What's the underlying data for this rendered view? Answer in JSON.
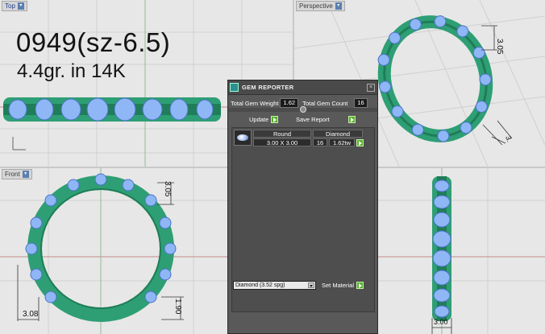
{
  "viewports": {
    "top": {
      "label": "Top"
    },
    "perspective": {
      "label": "Perspective"
    },
    "front": {
      "label": "Front"
    },
    "right": {
      "label": ""
    }
  },
  "annotation": {
    "line1": "0949(sz-6.5)",
    "line2": "4.4gr.  in 14K"
  },
  "dimensions": {
    "persp_height": "3.05",
    "persp_width": "3.",
    "front_height": "3.05",
    "front_bottom_width": "3.08",
    "front_bottom_height": "1.90",
    "right_width": "3.00"
  },
  "gem_reporter": {
    "title": "GEM REPORTER",
    "total_weight_label": "Total Gem Weight",
    "total_weight_value": "1.62",
    "total_count_label": "Total Gem Count",
    "total_count_value": "16",
    "update_label": "Update",
    "save_report_label": "Save Report",
    "columns": [
      "Round",
      "Diamond"
    ],
    "rows": [
      {
        "size": "3.00 X 3.00",
        "count": "16",
        "weight": "1.62tw"
      }
    ],
    "material_select": "Diamond     (3.52 spg)",
    "set_material_label": "Set Material"
  },
  "colors": {
    "ring_metal": "#2e9f74",
    "gem": "#8fb6f5",
    "viewport_bg": "#e7e7e7",
    "panel_bg": "#595959",
    "accent_red": "#c0392b"
  }
}
